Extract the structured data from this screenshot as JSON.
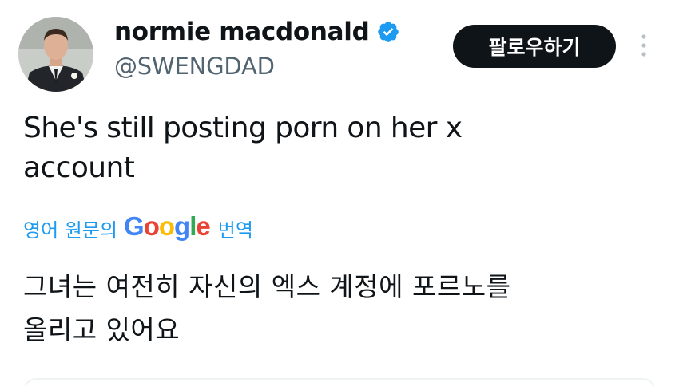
{
  "tweet": {
    "author": {
      "display_name": "normie macdonald",
      "handle": "@SWENGDAD",
      "verified": true,
      "verified_color": "#1d9bf0"
    },
    "follow_label": "팔로우하기",
    "more_icon": "more-vertical-icon",
    "text_line1": "She's still posting porn on her x",
    "text_line2": "account",
    "translate": {
      "prefix": "영어 원문의",
      "brand_letters": [
        "G",
        "o",
        "o",
        "g",
        "l",
        "e"
      ],
      "brand_colors": [
        "#4285f4",
        "#ea4335",
        "#fbbc05",
        "#4285f4",
        "#34a853",
        "#ea4335"
      ],
      "suffix": "번역",
      "link_color": "#1d9bf0"
    },
    "translated_line1": "그녀는 여전히 자신의 엑스 계정에 포르노를",
    "translated_line2": "올리고 있어요"
  }
}
